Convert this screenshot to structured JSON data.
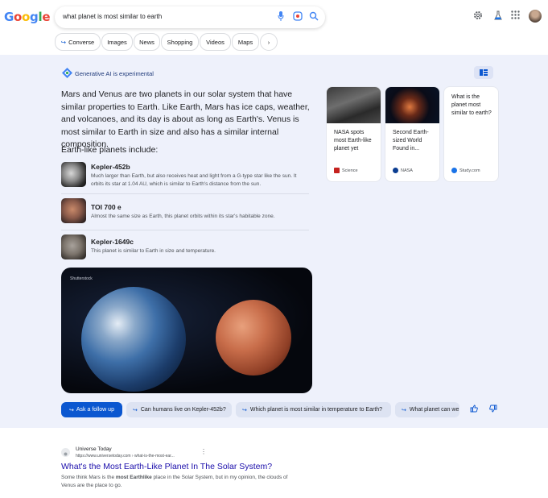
{
  "logo_letters": [
    "G",
    "o",
    "o",
    "g",
    "l",
    "e"
  ],
  "search": {
    "query": "what planet is most similar to earth"
  },
  "chips": [
    "Converse",
    "Images",
    "News",
    "Shopping",
    "Videos",
    "Maps",
    "›"
  ],
  "ai": {
    "badge": "Generative AI is experimental",
    "summary": "Mars and Venus are two planets in our solar system that have similar properties to Earth. Like Earth, Mars has ice caps, weather, and volcanoes, and its day is about as long as Earth's. Venus is most similar to Earth in size and also has a similar internal composition.",
    "list_heading": "Earth-like planets include:",
    "planets": [
      {
        "name": "Kepler-452b",
        "desc": "Much larger than Earth, but also receives heat and light from a G-type star like the sun. It orbits its star at 1.04 AU, which is similar to Earth's distance from the sun."
      },
      {
        "name": "TOI 700 e",
        "desc": "Almost the same size as Earth, this planet orbits within its star's habitable zone."
      },
      {
        "name": "Kepler-1649c",
        "desc": "This planet is similar to Earth in size and temperature."
      }
    ],
    "image_credit": "Shutterstock",
    "sources": [
      {
        "title": "NASA spots most Earth-like planet yet",
        "source": "Science",
        "dot": "#c5221f"
      },
      {
        "title": "Second Earth-sized World Found in...",
        "source": "NASA",
        "dot": "#0b3d91"
      },
      {
        "title": "What is the planet most similar to earth?",
        "source": "Study.com",
        "dot": "#1a73e8"
      }
    ],
    "followup": "Ask a follow up",
    "suggestions": [
      "Can humans live on Kepler-452b?",
      "Which planet is most similar in temperature to Earth?",
      "What planet can we"
    ]
  },
  "result": {
    "site": "Universe Today",
    "url": "https://www.universetoday.com › what-is-the-most-ear...",
    "title": "What's the Most Earth-Like Planet In The Solar System?",
    "snippet_pre": "Some think Mars is the ",
    "snippet_bold1": "most Earthlike",
    "snippet_mid": " place in the Solar System, but in my opinion, the clouds of Venus are the place to go."
  },
  "colors": {
    "accent": "#0b57d0",
    "panel_bg": "#eef1fb",
    "link": "#1a0dab"
  }
}
